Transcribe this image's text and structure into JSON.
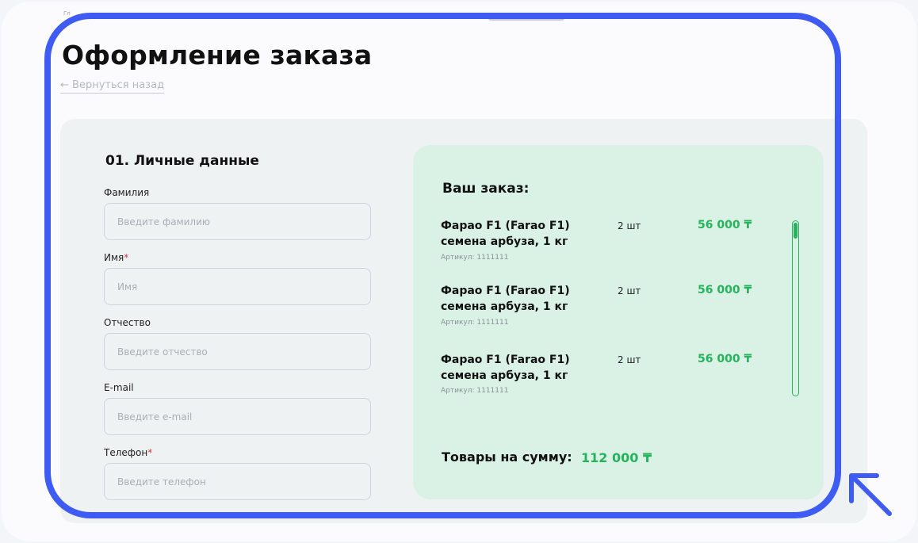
{
  "header": {
    "breadcrumb_stub": "Гл",
    "title": "Оформление заказа",
    "back_link": "← Вернуться назад"
  },
  "personal": {
    "section_title": "01. Личные данные",
    "fields": [
      {
        "label": "Фамилия",
        "required": false,
        "placeholder": "Введите фамилию"
      },
      {
        "label": "Имя",
        "required": true,
        "placeholder": "Имя"
      },
      {
        "label": "Отчество",
        "required": false,
        "placeholder": "Введите отчество"
      },
      {
        "label": "E-mail",
        "required": false,
        "placeholder": "Введите e-mail"
      },
      {
        "label": "Телефон",
        "required": true,
        "placeholder": "Введите телефон"
      }
    ],
    "required_mark": "*"
  },
  "order": {
    "title": "Ваш заказ:",
    "items": [
      {
        "name_line1": "Фарао F1 (Farao F1)",
        "name_line2": "семена арбуза, 1 кг",
        "sku": "Артикул: 1111111",
        "qty": "2 шт",
        "price": "56 000 ₸"
      },
      {
        "name_line1": "Фарао F1 (Farao F1)",
        "name_line2": "семена арбуза, 1 кг",
        "sku": "Артикул: 1111111",
        "qty": "2 шт",
        "price": "56 000 ₸"
      },
      {
        "name_line1": "Фарао F1 (Farao F1)",
        "name_line2": "семена арбуза, 1 кг",
        "sku": "Артикул: 1111111",
        "qty": "2 шт",
        "price": "56 000 ₸"
      }
    ],
    "total_label": "Товары на сумму:",
    "total_value": "112 000 ₸"
  },
  "colors": {
    "accent_green": "#25b35b",
    "highlight_blue": "#3e5cf4",
    "order_bg": "#daf1e6",
    "required_red": "#e0314b"
  },
  "icons": {
    "pointer": "arrow-up-left-icon"
  }
}
